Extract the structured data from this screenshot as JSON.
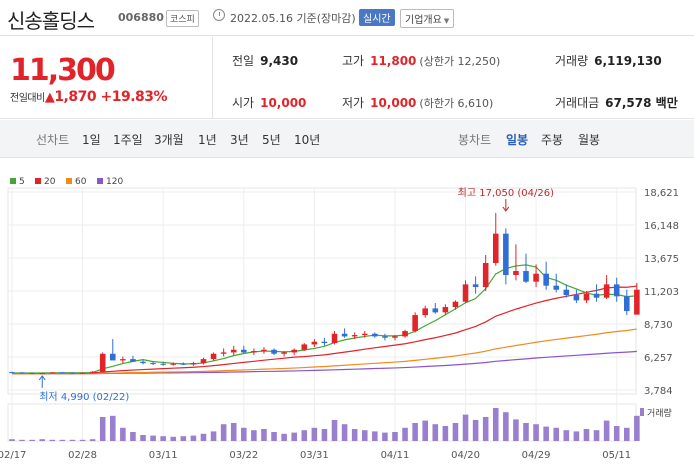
{
  "header": {
    "name": "신송홀딩스",
    "code": "006880",
    "market": "코스피",
    "date": "2022.05.16 기준(장마감)",
    "realtime": "실시간",
    "company_info": "기업개요"
  },
  "summary": {
    "price": "11,300",
    "change_label": "전일대비",
    "change_arrow": "▲",
    "change_value": "1,870",
    "change_pct": "+19.83%",
    "prev_label": "전일",
    "prev": "9,430",
    "high_label": "고가",
    "high": "11,800",
    "high_limit": "(상한가 12,250)",
    "volume_label": "거래량",
    "volume": "6,119,130",
    "open_label": "시가",
    "open": "10,000",
    "low_label": "저가",
    "low": "10,000",
    "low_limit": "(하한가 6,610)",
    "amount_label": "거래대금",
    "amount": "67,578 백만"
  },
  "toolbar": {
    "line_label": "선차트",
    "line_periods": [
      "1일",
      "1주일",
      "3개월",
      "1년",
      "3년",
      "5년",
      "10년"
    ],
    "candle_label": "봉차트",
    "candle_periods": [
      "일봉",
      "주봉",
      "월봉"
    ],
    "candle_active": "일봉"
  },
  "colors": {
    "up": "#e0242a",
    "down": "#2f6ed6",
    "ma5": "#43a831",
    "ma20": "#e0242a",
    "ma60": "#f08a1c",
    "ma120": "#8a55c8"
  },
  "chart_data": {
    "type": "candlestick",
    "legend": [
      {
        "name": "5",
        "color": "#43a831"
      },
      {
        "name": "20",
        "color": "#e0242a"
      },
      {
        "name": "60",
        "color": "#f08a1c"
      },
      {
        "name": "120",
        "color": "#8a55c8"
      }
    ],
    "y_ticks": [
      18621,
      16148,
      13675,
      11203,
      8730,
      6257,
      3784
    ],
    "y_tick_labels": [
      "18,621",
      "16,148",
      "13,675",
      "11,203",
      "8,730",
      "6,257",
      "3,784"
    ],
    "ylim": [
      3784,
      18621
    ],
    "x_tick_labels": [
      "02/17",
      "02/28",
      "03/11",
      "03/22",
      "03/31",
      "04/11",
      "04/20",
      "04/29",
      "05/11"
    ],
    "x_tick_index": [
      0,
      7,
      15,
      23,
      30,
      38,
      45,
      52,
      60
    ],
    "volume_label": "거래량",
    "annotations": {
      "high_text": "최고 17,050 (04/26)",
      "high_index": 49,
      "high_value": 17050,
      "low_text": "최저 4,990 (02/22)",
      "low_index": 3,
      "low_value": 4990
    },
    "candles": [
      [
        5120,
        5150,
        5050,
        5100
      ],
      [
        5100,
        5130,
        5020,
        5060
      ],
      [
        5060,
        5100,
        5000,
        5040
      ],
      [
        5040,
        5080,
        4990,
        5050
      ],
      [
        5050,
        5120,
        5020,
        5100
      ],
      [
        5100,
        5140,
        5050,
        5080
      ],
      [
        5080,
        5110,
        5030,
        5060
      ],
      [
        5060,
        5100,
        5020,
        5070
      ],
      [
        5070,
        5200,
        5040,
        5150
      ],
      [
        5150,
        6600,
        5100,
        6500
      ],
      [
        6500,
        7600,
        6300,
        6000
      ],
      [
        6000,
        6300,
        5800,
        6100
      ],
      [
        6100,
        6350,
        5900,
        5900
      ],
      [
        5900,
        6100,
        5700,
        5800
      ],
      [
        5800,
        5950,
        5650,
        5750
      ],
      [
        5750,
        5900,
        5600,
        5700
      ],
      [
        5700,
        5850,
        5600,
        5750
      ],
      [
        5750,
        5850,
        5650,
        5700
      ],
      [
        5700,
        5900,
        5600,
        5800
      ],
      [
        5800,
        6200,
        5700,
        6100
      ],
      [
        6100,
        6600,
        6000,
        6500
      ],
      [
        6500,
        6900,
        6300,
        6600
      ],
      [
        6600,
        7100,
        6400,
        6800
      ],
      [
        6800,
        7100,
        6500,
        6600
      ],
      [
        6600,
        6900,
        6400,
        6700
      ],
      [
        6700,
        7000,
        6500,
        6800
      ],
      [
        6800,
        6900,
        6400,
        6500
      ],
      [
        6500,
        6700,
        6300,
        6600
      ],
      [
        6600,
        6900,
        6400,
        6800
      ],
      [
        6800,
        7300,
        6700,
        7200
      ],
      [
        7200,
        7600,
        7000,
        7400
      ],
      [
        7400,
        7700,
        7100,
        7300
      ],
      [
        7300,
        8200,
        7200,
        8000
      ],
      [
        8000,
        8400,
        7700,
        7800
      ],
      [
        7800,
        8100,
        7600,
        7900
      ],
      [
        7900,
        8200,
        7700,
        8000
      ],
      [
        8000,
        8100,
        7700,
        7800
      ],
      [
        7800,
        8000,
        7500,
        7700
      ],
      [
        7700,
        7900,
        7500,
        7800
      ],
      [
        7800,
        8300,
        7700,
        8200
      ],
      [
        8200,
        9600,
        8100,
        9400
      ],
      [
        9400,
        10100,
        9200,
        9900
      ],
      [
        9900,
        10300,
        9500,
        9600
      ],
      [
        9600,
        10200,
        9400,
        10000
      ],
      [
        10000,
        10500,
        9800,
        10400
      ],
      [
        10400,
        12000,
        10300,
        11700
      ],
      [
        11700,
        12300,
        11000,
        11500
      ],
      [
        11500,
        13900,
        11200,
        13300
      ],
      [
        13300,
        17050,
        13100,
        15500
      ],
      [
        15500,
        15900,
        11700,
        12400
      ],
      [
        12400,
        14700,
        12000,
        12700
      ],
      [
        12700,
        14000,
        11800,
        11900
      ],
      [
        11900,
        13200,
        11500,
        12500
      ],
      [
        12500,
        13400,
        11300,
        11600
      ],
      [
        11600,
        12500,
        11100,
        11300
      ],
      [
        11300,
        11700,
        10700,
        10900
      ],
      [
        10900,
        11300,
        10300,
        10500
      ],
      [
        10500,
        11200,
        10300,
        11000
      ],
      [
        11000,
        11700,
        10400,
        10700
      ],
      [
        10700,
        12400,
        10600,
        11700
      ],
      [
        11700,
        12200,
        10400,
        10800
      ],
      [
        10800,
        11300,
        9400,
        9700
      ],
      [
        9430,
        11800,
        10000,
        11300
      ]
    ],
    "volumes": [
      3,
      2,
      2,
      3,
      2,
      2,
      2,
      2,
      3,
      40,
      42,
      22,
      15,
      10,
      9,
      8,
      7,
      8,
      9,
      12,
      16,
      28,
      30,
      22,
      18,
      20,
      15,
      12,
      14,
      18,
      22,
      20,
      35,
      28,
      20,
      18,
      16,
      14,
      15,
      22,
      30,
      34,
      28,
      25,
      30,
      44,
      35,
      40,
      55,
      48,
      36,
      30,
      28,
      24,
      22,
      18,
      16,
      20,
      18,
      34,
      25,
      22,
      42
    ]
  }
}
